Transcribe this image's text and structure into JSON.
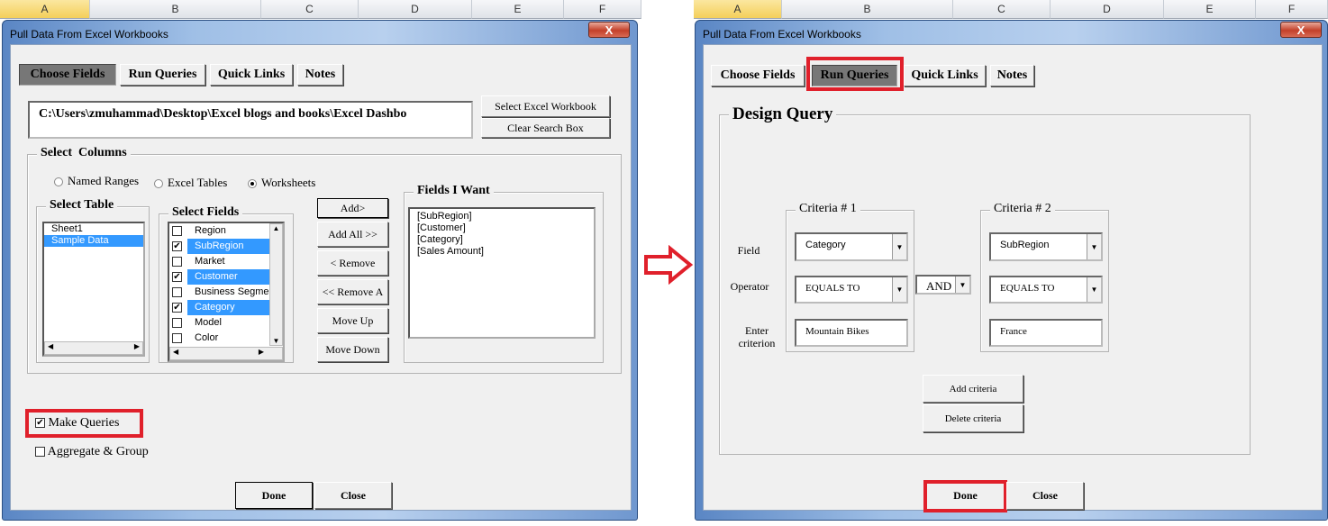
{
  "columns_left": [
    "A",
    "B",
    "C",
    "D",
    "E",
    "F"
  ],
  "columns_right": [
    "A",
    "B",
    "C",
    "D",
    "E",
    "F"
  ],
  "left_dialog": {
    "title": "Pull Data From Excel Workbooks",
    "close_glyph": "X",
    "tabs": [
      {
        "label": "Choose Fields",
        "active": true
      },
      {
        "label": "Run Queries"
      },
      {
        "label": "Quick Links"
      },
      {
        "label": "Notes"
      }
    ],
    "path": "C:\\Users\\zmuhammad\\Desktop\\Excel blogs and books\\Excel Dashbo",
    "select_workbook": "Select Excel Workbook",
    "clear_search": "Clear Search Box",
    "select_columns": "Select  Columns",
    "radios": [
      {
        "label": "Named Ranges",
        "checked": false
      },
      {
        "label": "Excel Tables",
        "checked": false
      },
      {
        "label": "Worksheets",
        "checked": true
      }
    ],
    "select_table": {
      "legend": "Select Table",
      "items": [
        {
          "label": "Sheet1",
          "selected": false
        },
        {
          "label": "Sample Data",
          "selected": true
        }
      ]
    },
    "select_fields": {
      "legend": "Select Fields",
      "items": [
        {
          "label": "Region",
          "checked": false
        },
        {
          "label": "SubRegion",
          "checked": true
        },
        {
          "label": "Market",
          "checked": false
        },
        {
          "label": "Customer",
          "checked": true
        },
        {
          "label": "Business Segmen",
          "checked": false
        },
        {
          "label": "Category",
          "checked": true
        },
        {
          "label": "Model",
          "checked": false
        },
        {
          "label": "Color",
          "checked": false
        }
      ]
    },
    "buttons": [
      "Add>",
      "Add All >>",
      "< Remove",
      "<< Remove A",
      "Move Up",
      "Move Down"
    ],
    "fields_i_want": {
      "legend": "Fields I Want",
      "items": [
        "[SubRegion]",
        "[Customer]",
        "[Category]",
        "[Sales Amount]"
      ]
    },
    "make_queries": {
      "label": "Make Queries",
      "checked": true
    },
    "aggregate": {
      "label": "Aggregate & Group",
      "checked": false
    },
    "done": "Done",
    "close": "Close"
  },
  "right_dialog": {
    "title": "Pull Data From Excel Workbooks",
    "close_glyph": "X",
    "tabs": [
      {
        "label": "Choose Fields"
      },
      {
        "label": "Run Queries",
        "active": true
      },
      {
        "label": "Quick Links"
      },
      {
        "label": "Notes"
      }
    ],
    "design_query": "Design Query",
    "labels": {
      "field": "Field",
      "operator": "Operator",
      "enter": "Enter",
      "criterion": "criterion"
    },
    "criteria": [
      {
        "legend": "Criteria # 1",
        "field": "Category",
        "operator": "EQUALS TO",
        "value": "Mountain Bikes"
      },
      {
        "legend": "Criteria # 2",
        "field": "SubRegion",
        "operator": "EQUALS TO",
        "value": "France"
      }
    ],
    "join": "AND",
    "add_criteria": "Add criteria",
    "delete_criteria": "Delete criteria",
    "done": "Done",
    "close": "Close"
  },
  "highlight_color": "#e0202b",
  "selection_color": "#3399ff"
}
